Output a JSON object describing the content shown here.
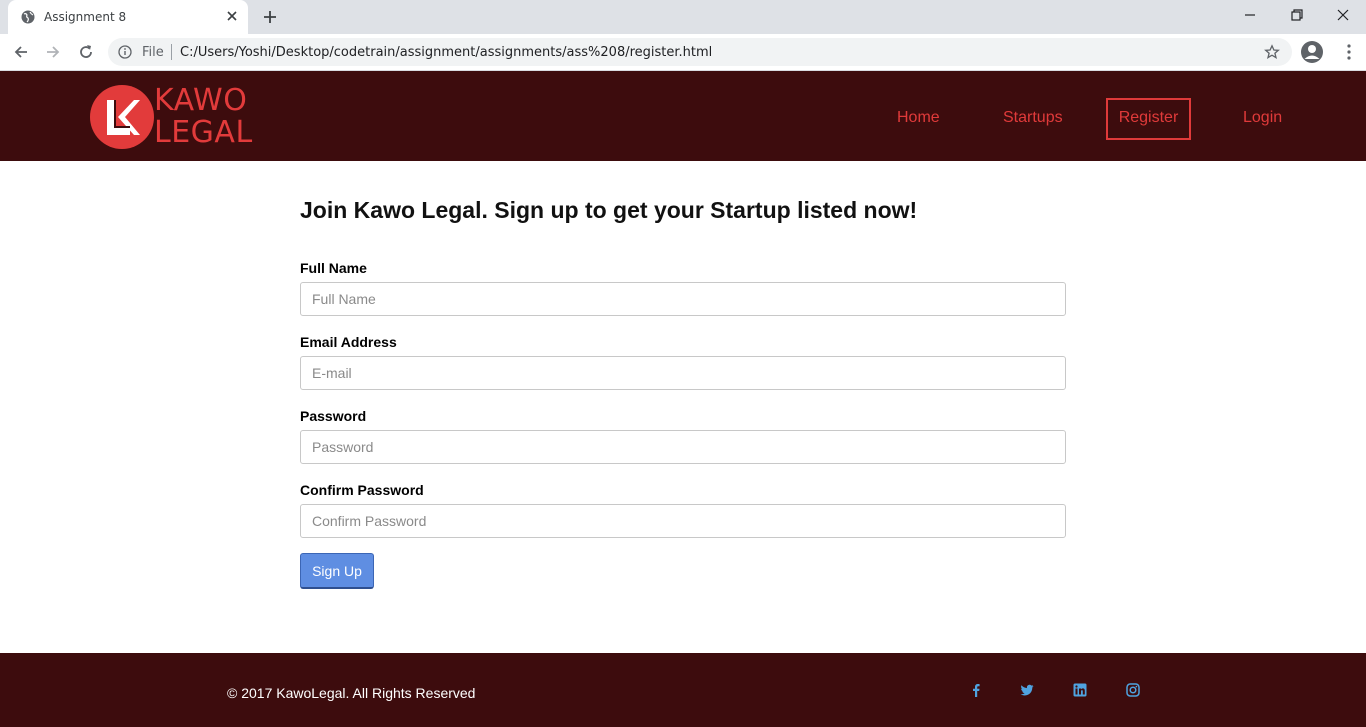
{
  "browser": {
    "tab_title": "Assignment 8",
    "address_scheme": "File",
    "url": "C:/Users/Yoshi/Desktop/codetrain/assignment/assignments/ass%208/register.html"
  },
  "header": {
    "logo_line1": "KAWO",
    "logo_line2": "LEGAL",
    "nav": {
      "home": "Home",
      "startups": "Startups",
      "register": "Register",
      "login": "Login"
    }
  },
  "form": {
    "heading": "Join Kawo Legal. Sign up to get your Startup listed now!",
    "full_name_label": "Full Name",
    "full_name_placeholder": "Full Name",
    "email_label": "Email Address",
    "email_placeholder": "E-mail",
    "password_label": "Password",
    "password_placeholder": "Password",
    "confirm_label": "Confirm Password",
    "confirm_placeholder": "Confirm Password",
    "submit_label": "Sign Up"
  },
  "footer": {
    "copyright": "© 2017 KawoLegal. All Rights Reserved",
    "social_icons": [
      "facebook-icon",
      "twitter-icon",
      "linkedin-icon",
      "instagram-icon"
    ]
  },
  "colors": {
    "brand_dark": "#3d0c0d",
    "brand_red": "#e03a3a",
    "button_blue": "#5f8ee2",
    "social_blue": "#4fa3e0"
  }
}
